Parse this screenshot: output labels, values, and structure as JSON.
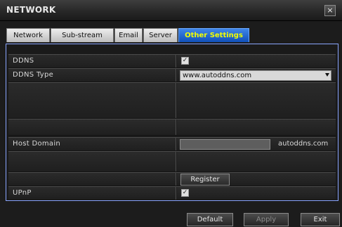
{
  "window": {
    "title": "NETWORK",
    "close_glyph": "×",
    "close_icon": "close-icon"
  },
  "tabs": [
    {
      "label": "Network",
      "active": false
    },
    {
      "label": "Sub-stream",
      "active": false
    },
    {
      "label": "Email",
      "active": false
    },
    {
      "label": "Server",
      "active": false
    },
    {
      "label": "Other Settings",
      "active": true
    }
  ],
  "rows": {
    "ddns": {
      "label": "DDNS",
      "checked": true,
      "check_glyph": "✓"
    },
    "ddns_type": {
      "label": "DDNS Type",
      "value": "www.autoddns.com"
    },
    "host_domain": {
      "label": "Host Domain",
      "value": "",
      "suffix": "autoddns.com"
    },
    "register": {
      "label": "Register"
    },
    "upnp": {
      "label": "UPnP",
      "checked": true,
      "check_glyph": "✓"
    }
  },
  "buttons": {
    "default": "Default",
    "apply": "Apply",
    "exit": "Exit"
  },
  "colors": {
    "active_tab": "#0f4fb9",
    "active_tab_text": "#f2ff00",
    "panel_border": "#8aa6ff"
  }
}
